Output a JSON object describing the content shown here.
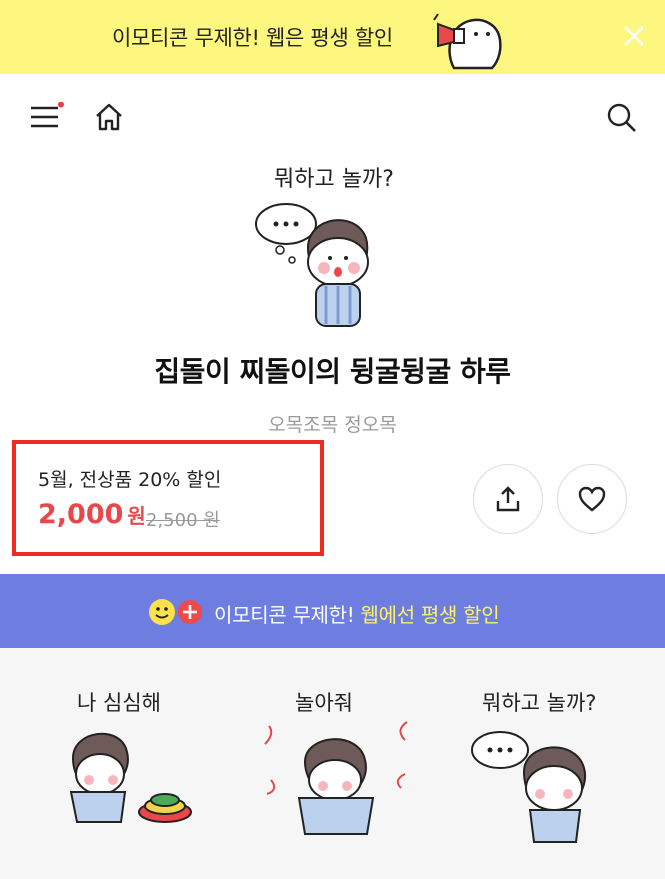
{
  "banner": {
    "text": "이모티콘 무제한! 웹은 평생 할인",
    "mascot_icon": "megaphone-mascot-icon",
    "close_icon": "close-icon"
  },
  "navbar": {
    "menu_icon": "menu-icon",
    "home_icon": "home-icon",
    "search_icon": "search-icon",
    "notification_dot_color": "#ef3b3b"
  },
  "hero": {
    "speech_text": "뭐하고 놀까?"
  },
  "product": {
    "title": "집돌이 찌돌이의 뒹굴뒹굴 하루",
    "author": "오목조목 정오목"
  },
  "pricing": {
    "promo": "5월, 전상품 20% 할인",
    "price": "2,000",
    "currency": "원",
    "original_price": "2,500 원"
  },
  "actions": {
    "share_icon": "share-icon",
    "like_icon": "heart-icon"
  },
  "promo_bar": {
    "text_plain": "이모티콘 무제한! ",
    "text_highlight": "웹에선 평생 할인",
    "bg_color": "#6e7ee0",
    "highlight_color": "#fff26a"
  },
  "stickers": [
    {
      "caption": "나 심심해"
    },
    {
      "caption": "놀아줘"
    },
    {
      "caption": "뭐하고 놀까?"
    }
  ],
  "colors": {
    "banner_bg": "#fef77f",
    "price_red": "#e8484a",
    "highlight_border": "#ef2b1f"
  }
}
